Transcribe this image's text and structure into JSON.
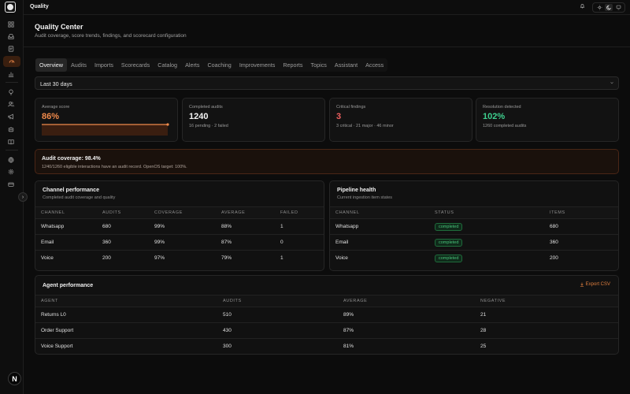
{
  "app": {
    "title": "Quality"
  },
  "header": {
    "title": "Quality Center",
    "subtitle": "Audit coverage, score trends, findings, and scorecard configuration"
  },
  "tabs": [
    {
      "label": "Overview",
      "active": true
    },
    {
      "label": "Audits"
    },
    {
      "label": "Imports"
    },
    {
      "label": "Scorecards"
    },
    {
      "label": "Catalog"
    },
    {
      "label": "Alerts"
    },
    {
      "label": "Coaching"
    },
    {
      "label": "Improvements"
    },
    {
      "label": "Reports"
    },
    {
      "label": "Topics"
    },
    {
      "label": "Assistant"
    },
    {
      "label": "Access"
    }
  ],
  "date_range": {
    "value": "Last 30 days"
  },
  "kpis": {
    "average_score": {
      "label": "Average score",
      "value": "86%",
      "color": "#f08a4b",
      "trend_level": 0.86
    },
    "completed_audits": {
      "label": "Completed audits",
      "value": "1240",
      "sub": "16 pending · 2 failed",
      "color": "#f2f2f2"
    },
    "critical_findings": {
      "label": "Critical findings",
      "value": "3",
      "sub": "3 critical · 21 major · 46 minor",
      "color": "#f06060"
    },
    "resolution": {
      "label": "Resolution detected",
      "value": "102%",
      "sub": "1260 completed audits",
      "color": "#3ecf8e"
    }
  },
  "coverage": {
    "title": "Audit coverage: 98.4%",
    "detail": "1240/1260 eligible interactions have an audit record. OpenOS target: 100%."
  },
  "channel_performance": {
    "title": "Channel performance",
    "subtitle": "Completed audit coverage and quality",
    "columns": [
      "CHANNEL",
      "AUDITS",
      "COVERAGE",
      "AVERAGE",
      "FAILED"
    ],
    "rows": [
      [
        "Whatsapp",
        "680",
        "99%",
        "88%",
        "1"
      ],
      [
        "Email",
        "360",
        "99%",
        "87%",
        "0"
      ],
      [
        "Voice",
        "200",
        "97%",
        "79%",
        "1"
      ]
    ]
  },
  "pipeline_health": {
    "title": "Pipeline health",
    "subtitle": "Current ingestion item states",
    "columns": [
      "CHANNEL",
      "STATUS",
      "ITEMS"
    ],
    "rows": [
      [
        "Whatsapp",
        "completed",
        "680"
      ],
      [
        "Email",
        "completed",
        "360"
      ],
      [
        "Voice",
        "completed",
        "200"
      ]
    ]
  },
  "agent_performance": {
    "title": "Agent performance",
    "export_label": "Export CSV",
    "columns": [
      "AGENT",
      "AUDITS",
      "AVERAGE",
      "NEGATIVE"
    ],
    "rows": [
      [
        "Returns L0",
        "510",
        "89%",
        "21"
      ],
      [
        "Order Support",
        "430",
        "87%",
        "28"
      ],
      [
        "Voice Support",
        "300",
        "81%",
        "25"
      ]
    ]
  },
  "user": {
    "initial": "N"
  },
  "icons": {
    "rail": [
      "dashboard-icon",
      "inbox-icon",
      "document-icon",
      "quality-icon",
      "chart-icon",
      "bulb-icon",
      "users-icon",
      "megaphone-icon",
      "bot-icon",
      "book-icon",
      "globe-icon",
      "settings-icon",
      "card-icon"
    ],
    "topbar": [
      "bell-icon",
      "sun-icon",
      "moon-icon",
      "monitor-icon"
    ]
  },
  "colors": {
    "accent": "#f08a4b",
    "success": "#3ecf8e",
    "danger": "#f06060"
  }
}
